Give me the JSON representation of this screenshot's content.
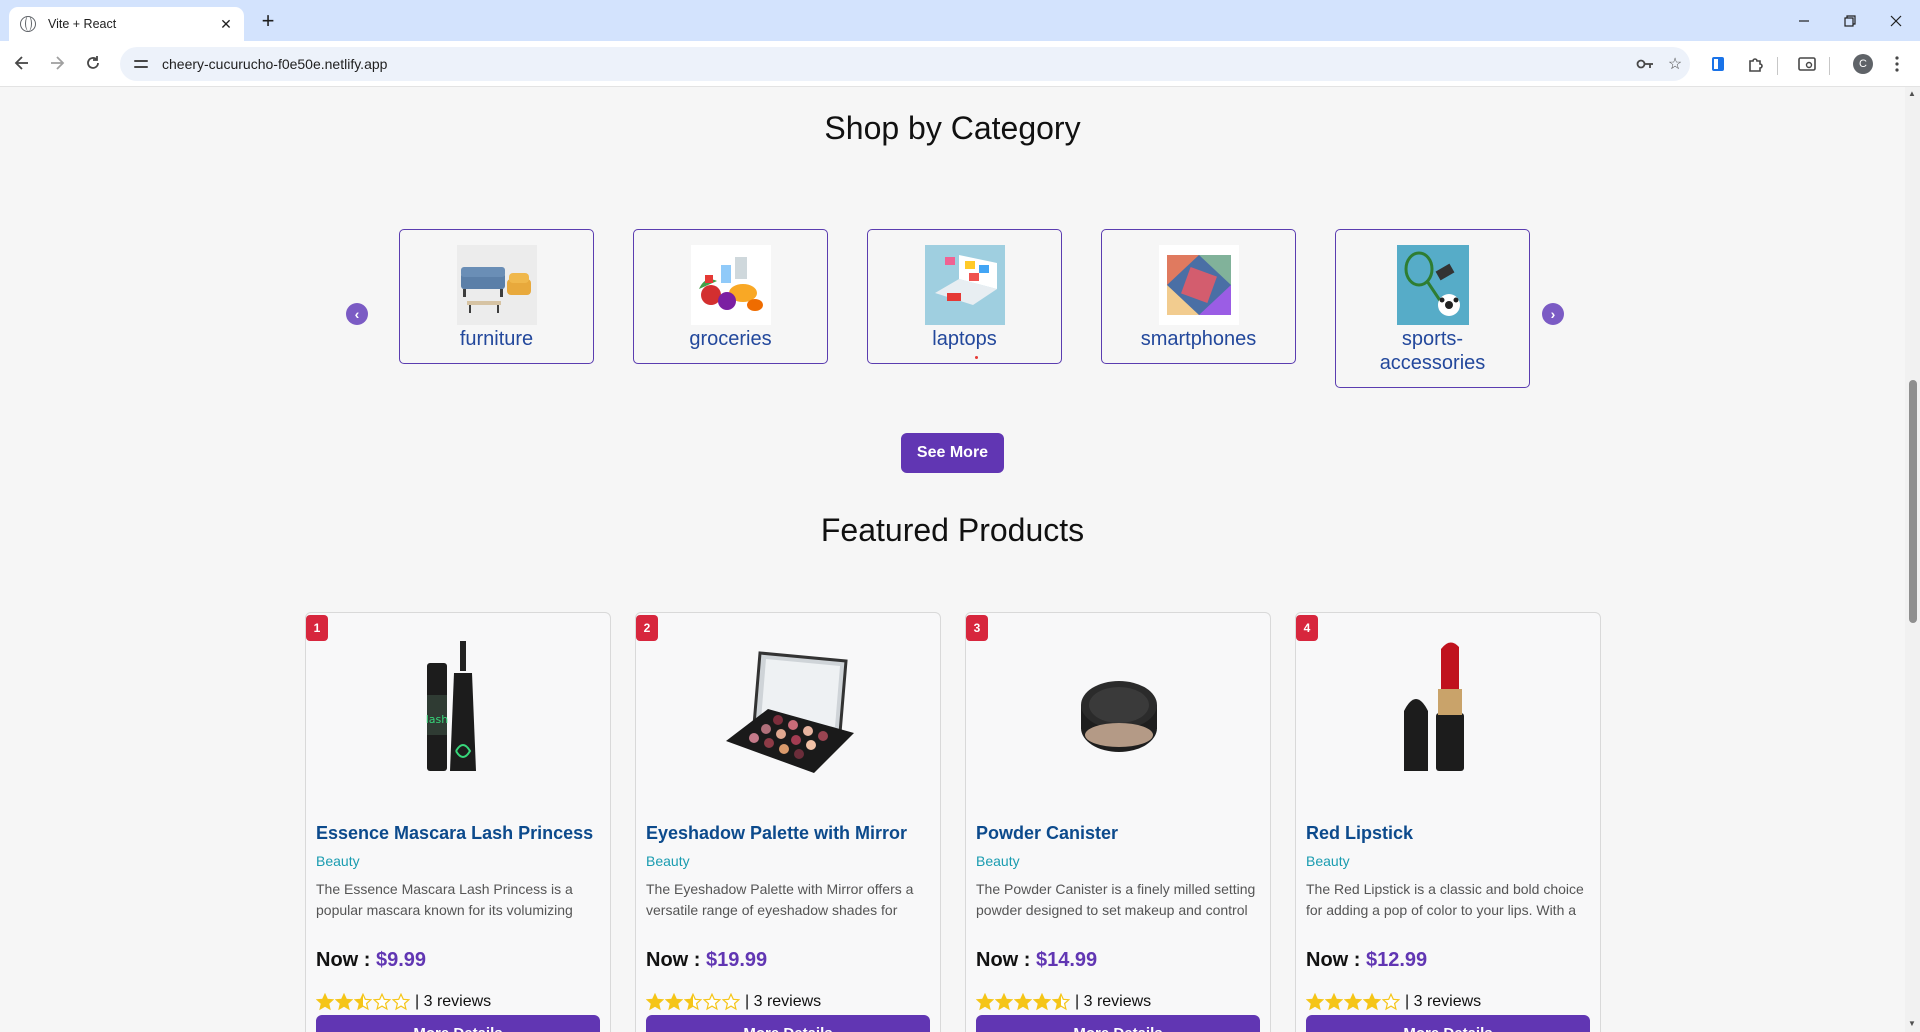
{
  "browser": {
    "tab_title": "Vite + React",
    "url": "cheery-cucurucho-f0e50e.netlify.app",
    "profile_initial": "C"
  },
  "category_section": {
    "title": "Shop by Category",
    "categories": [
      {
        "label": "furniture",
        "icon": "furniture-sofa-image"
      },
      {
        "label": "groceries",
        "icon": "groceries-image"
      },
      {
        "label": "laptops",
        "icon": "laptops-image"
      },
      {
        "label": "smartphones",
        "icon": "smartphones-image"
      },
      {
        "label": "sports-\naccessories",
        "icon": "sports-accessories-image"
      }
    ],
    "see_more_label": "See More"
  },
  "featured_section": {
    "title": "Featured Products",
    "products": [
      {
        "rank": "1",
        "name": "Essence Mascara Lash Princess",
        "category": "Beauty",
        "description": "The Essence Mascara Lash Princess is a popular mascara known for its volumizing",
        "price_prefix": "Now : ",
        "price": "$9.99",
        "rating": 2.5,
        "reviews": "| 3 reviews",
        "button_label": "More Details"
      },
      {
        "rank": "2",
        "name": "Eyeshadow Palette with Mirror",
        "category": "Beauty",
        "description": "The Eyeshadow Palette with Mirror offers a versatile range of eyeshadow shades for",
        "price_prefix": "Now : ",
        "price": "$19.99",
        "rating": 2.5,
        "reviews": "| 3 reviews",
        "button_label": "More Details"
      },
      {
        "rank": "3",
        "name": "Powder Canister",
        "category": "Beauty",
        "description": "The Powder Canister is a finely milled setting powder designed to set makeup and control",
        "price_prefix": "Now : ",
        "price": "$14.99",
        "rating": 4.5,
        "reviews": "| 3 reviews",
        "button_label": "More Details"
      },
      {
        "rank": "4",
        "name": "Red Lipstick",
        "category": "Beauty",
        "description": "The Red Lipstick is a classic and bold choice for adding a pop of color to your lips. With a",
        "price_prefix": "Now : ",
        "price": "$12.99",
        "rating": 4,
        "reviews": "| 3 reviews",
        "button_label": "More Details"
      }
    ]
  },
  "colors": {
    "accent": "#6136b3",
    "star": "#f5c518",
    "badge": "#d7263d",
    "category_label": "#23489c"
  }
}
